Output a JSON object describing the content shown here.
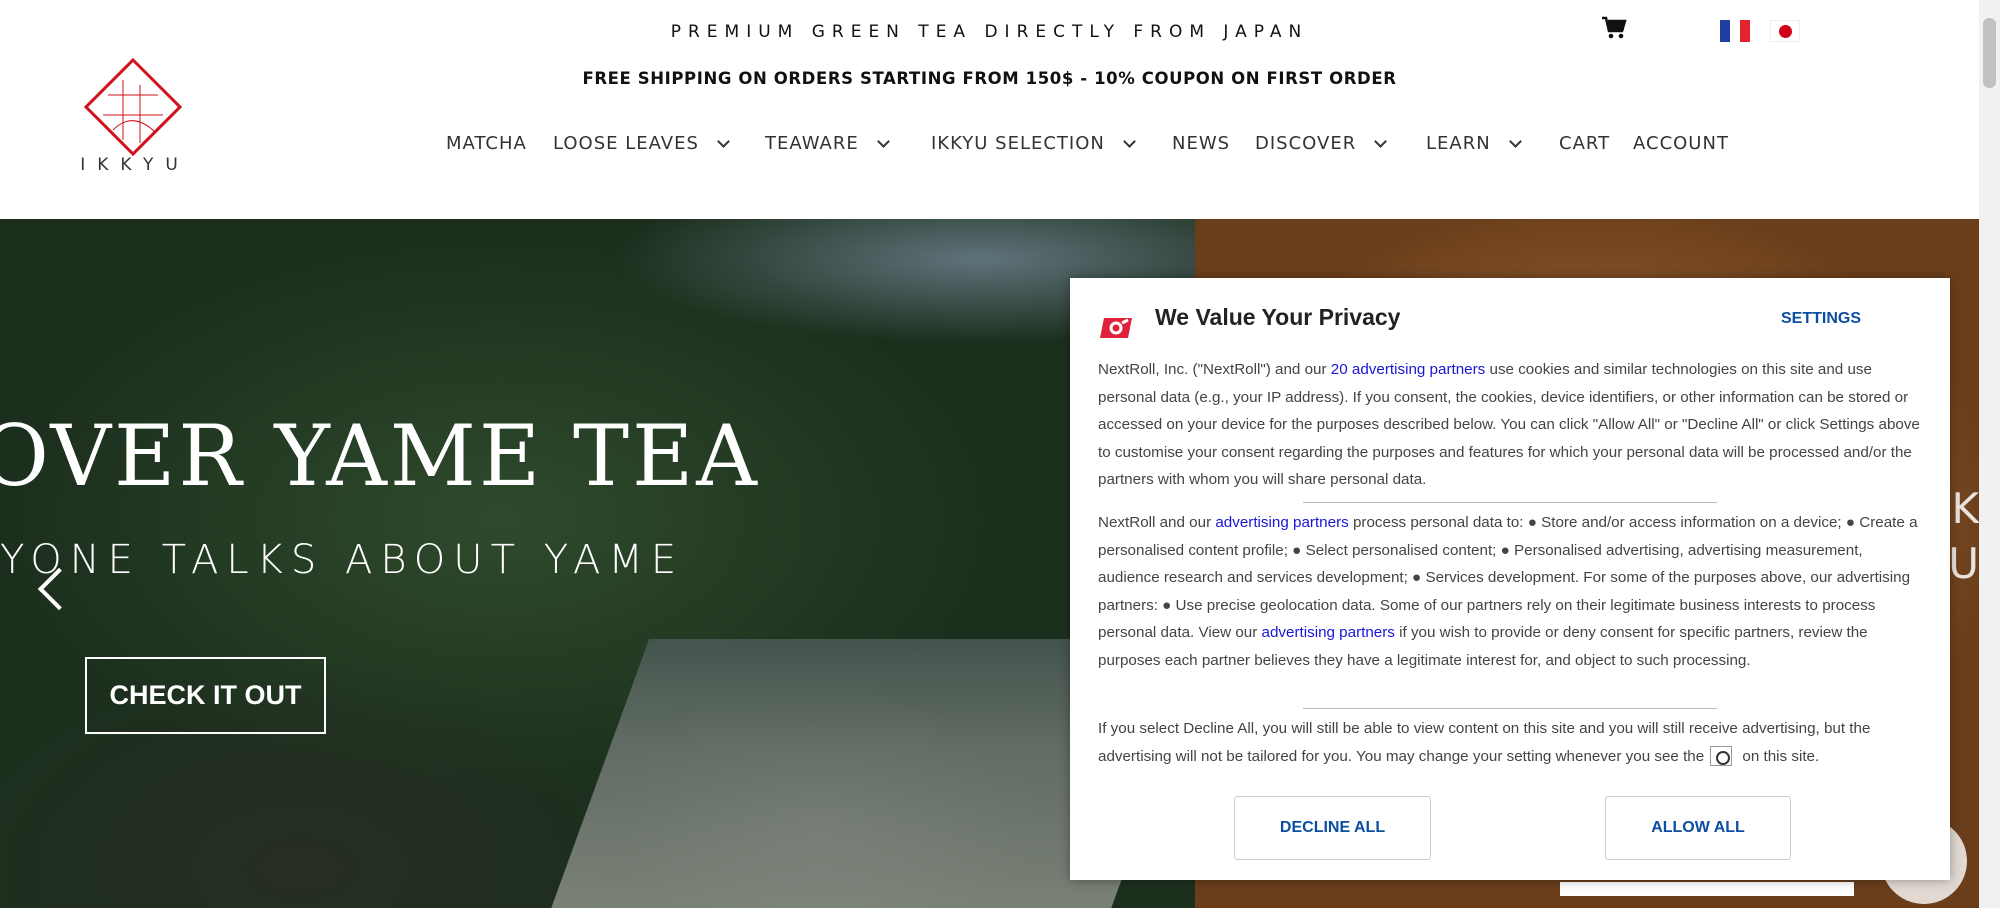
{
  "header": {
    "tagline": "PREMIUM GREEN TEA DIRECTLY FROM JAPAN",
    "shipping": "FREE SHIPPING ON ORDERS STARTING FROM 150$ - 10% COUPON ON FIRST ORDER",
    "logo_text": "IKKYU",
    "cart_icon": "shopping-cart-icon",
    "flags": [
      "france-flag",
      "japan-flag"
    ]
  },
  "nav": {
    "items": [
      {
        "label": "MATCHA",
        "dropdown": false
      },
      {
        "label": "LOOSE LEAVES",
        "dropdown": true
      },
      {
        "label": "TEAWARE",
        "dropdown": true
      },
      {
        "label": "IKKYU SELECTION",
        "dropdown": true
      },
      {
        "label": "NEWS",
        "dropdown": false
      },
      {
        "label": "DISCOVER",
        "dropdown": true
      },
      {
        "label": "LEARN",
        "dropdown": true
      },
      {
        "label": "CART",
        "dropdown": false
      },
      {
        "label": "ACCOUNT",
        "dropdown": false
      }
    ]
  },
  "hero": {
    "title": "OVER YAME TEA",
    "subtitle": "YONE TALKS ABOUT YAME",
    "cta": "CHECK IT OUT",
    "right_peek_1": "K",
    "right_peek_2": "U"
  },
  "privacy": {
    "title": "We Value Your Privacy",
    "settings": "SETTINGS",
    "p1_a": "NextRoll, Inc. (\"NextRoll\") and our ",
    "p1_link": "20 advertising partners",
    "p1_b": " use cookies and similar technologies on this site and use personal data (e.g., your IP address). If you consent, the cookies, device identifiers, or other information can be stored or accessed on your device for the purposes described below. You can click \"Allow All\" or \"Decline All\" or click Settings above to customise your consent regarding the purposes and features for which your personal data will be processed and/or the partners with whom you will share personal data.",
    "p2_a": "NextRoll and our ",
    "p2_link1": "advertising partners",
    "p2_b": " process personal data to: ● Store and/or access information on a device; ● Create a personalised content profile; ● Select personalised content; ● Personalised advertising, advertising measurement, audience research and services development; ● Services development. For some of the purposes above, our advertising partners: ● Use precise geolocation data. Some of our partners rely on their legitimate business interests to process personal data. View our ",
    "p2_link2": "advertising partners",
    "p2_c": " if you wish to provide or deny consent for specific partners, review the purposes each partner believes they have a legitimate interest for, and object to such processing.",
    "p3_a": "If you select Decline All, you will still be able to view content on this site and you will still receive advertising, but the advertising will not be tailored for you. You may change your setting whenever you see the ",
    "p3_b": "on this site.",
    "decline": "DECLINE ALL",
    "allow": "ALLOW ALL"
  }
}
